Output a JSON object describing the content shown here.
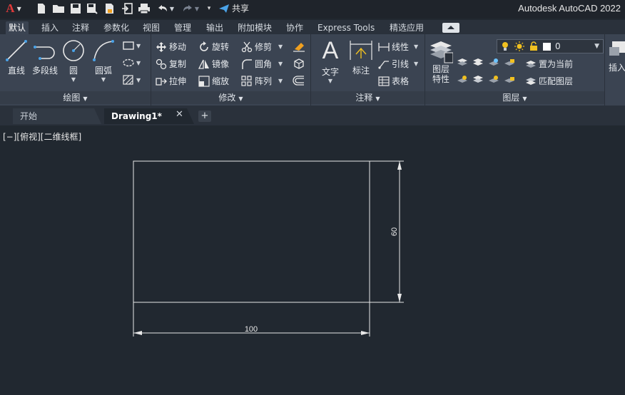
{
  "app": {
    "title": "Autodesk AutoCAD 2022",
    "share_label": "共享",
    "logo_letter": "A"
  },
  "ribbon_tabs": [
    "默认",
    "插入",
    "注释",
    "参数化",
    "视图",
    "管理",
    "输出",
    "附加模块",
    "协作",
    "Express Tools",
    "精选应用"
  ],
  "active_tab": "默认",
  "panels": {
    "draw": {
      "title": "绘图",
      "line": "直线",
      "polyline": "多段线",
      "circle": "圆",
      "arc": "圆弧"
    },
    "modify": {
      "title": "修改",
      "move": "移动",
      "rotate": "旋转",
      "trim": "修剪",
      "copy": "复制",
      "mirror": "镜像",
      "fillet": "圆角",
      "stretch": "拉伸",
      "scale": "缩放",
      "array": "阵列"
    },
    "annotation": {
      "title": "注释",
      "text": "文字",
      "dimension": "标注",
      "linear": "线性",
      "leader": "引线",
      "table": "表格"
    },
    "layers": {
      "title": "图层",
      "properties": "图层\n特性",
      "properties_line1": "图层",
      "properties_line2": "特性",
      "current_layer": "0",
      "set_current": "置为当前",
      "match_layer": "匹配图层"
    },
    "insert": {
      "label": "插入"
    }
  },
  "file_tabs": {
    "start": "开始",
    "drawing": "Drawing1*"
  },
  "viewport": {
    "label": "[−][俯视][二维线框]"
  },
  "drawing": {
    "rect_width_dim": "100",
    "rect_height_dim": "60"
  },
  "colors": {
    "background": "#212830",
    "ribbon": "#3b4452",
    "linework": "#e8e8e8",
    "logo": "#e03a3a",
    "share": "#4aa3e8"
  }
}
